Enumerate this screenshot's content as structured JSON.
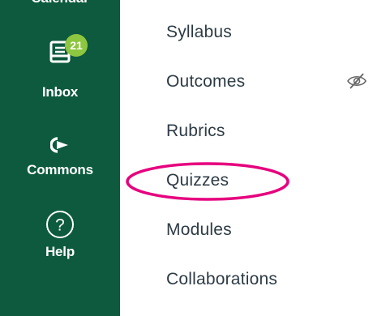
{
  "global_nav": {
    "background_color": "#0d5a3e",
    "items": [
      {
        "label": "Calendar",
        "icon": "calendar-icon"
      },
      {
        "label": "Inbox",
        "icon": "inbox-icon",
        "badge": "21"
      },
      {
        "label": "Commons",
        "icon": "commons-icon"
      },
      {
        "label": "Help",
        "icon": "help-icon"
      }
    ]
  },
  "course_nav": {
    "items": [
      {
        "label": "Syllabus"
      },
      {
        "label": "Outcomes",
        "status_icon": "eye-hidden-icon"
      },
      {
        "label": "Rubrics"
      },
      {
        "label": "Quizzes",
        "highlighted": true
      },
      {
        "label": "Modules"
      },
      {
        "label": "Collaborations"
      }
    ],
    "link_color": "#2d3b45",
    "highlight_color": "#e6007e"
  },
  "badge_color": "#8dc63f"
}
